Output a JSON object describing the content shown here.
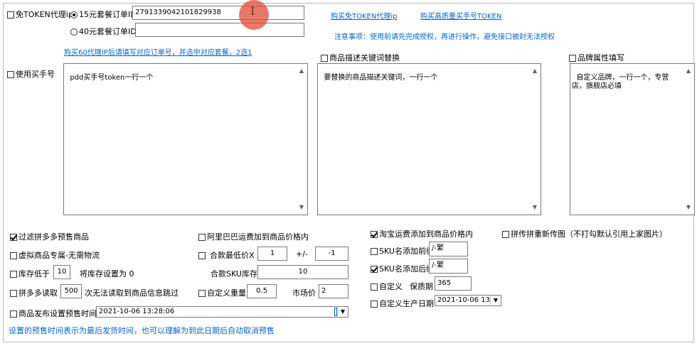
{
  "row1": {
    "free_token": "免TOKEN代理ip",
    "radio15_label": "15元套餐订单ID",
    "order15_value": "2791339042101829938",
    "radio40_label": "40元套餐订单ID",
    "order40_value": "",
    "link_buy_free": "购买免TOKEN代理ip",
    "link_buy_token": "购买高质量买手号TOKEN",
    "notice": "注意事项：使用前请先完成授权，再进行操作，避免接口被封无法授权",
    "buy_hint": "购买60代理IP后请填写对应订单号，并选中对应套餐，2选1"
  },
  "mid": {
    "use_buyer": "使用买手号",
    "buyer_text": "pdd买手号token一行一个",
    "desc_replace": "商品描述关键词替换",
    "desc_text": "要替换的商品描述关键词，一行一个",
    "brand_fill": "品牌属性填写",
    "brand_text": "自定义品牌，一行一个，专营店，旗舰店必填"
  },
  "opts": {
    "filter_presale": "过滤拼多多预售商品",
    "virtual_goods": "虚拟商品专属-无需物流",
    "stock_low": "库存低于",
    "stock_low_value": "10",
    "stock_set": "将库存设置为 0",
    "read_count": "拼多多读取",
    "read_count_value": "500",
    "read_skip": "次无法读取到商品信息跳过",
    "release_presale": "商品发布设置预售时间",
    "presale_date": "2021-10-06 13:28:06",
    "presale_note": "设置的预售时间表示为最后发货时间，也可以理解为到此日期后自动取消预售",
    "ali_freight": "阿里巴巴运费加到商品价格内",
    "min_price": "合款最低价X",
    "min_price_value": "1",
    "plus_minus": "+/-",
    "pm_value": "-1",
    "sku_stock_label": "合款SKU库存",
    "sku_stock_value": "10",
    "custom_weight": "自定义重量",
    "weight_value": "0.5",
    "market_label": "市场价",
    "market_value": "2",
    "taobao_freight": "淘宝运费添加到商品价格内",
    "sku_prefix": "SKU名添加前缀",
    "sku_prefix_value": "/-繁",
    "sku_suffix": "SKU名添加后缀",
    "sku_suffix_value": "/-繁",
    "custom_label": "自定义",
    "shelf_label": "保质期",
    "shelf_value": "365",
    "custom_date": "自定义生产日期",
    "produce_date": "2021-10-06 13:",
    "repost_img": "拼传拼重新传图（不打勾默认引用上家图片）"
  }
}
